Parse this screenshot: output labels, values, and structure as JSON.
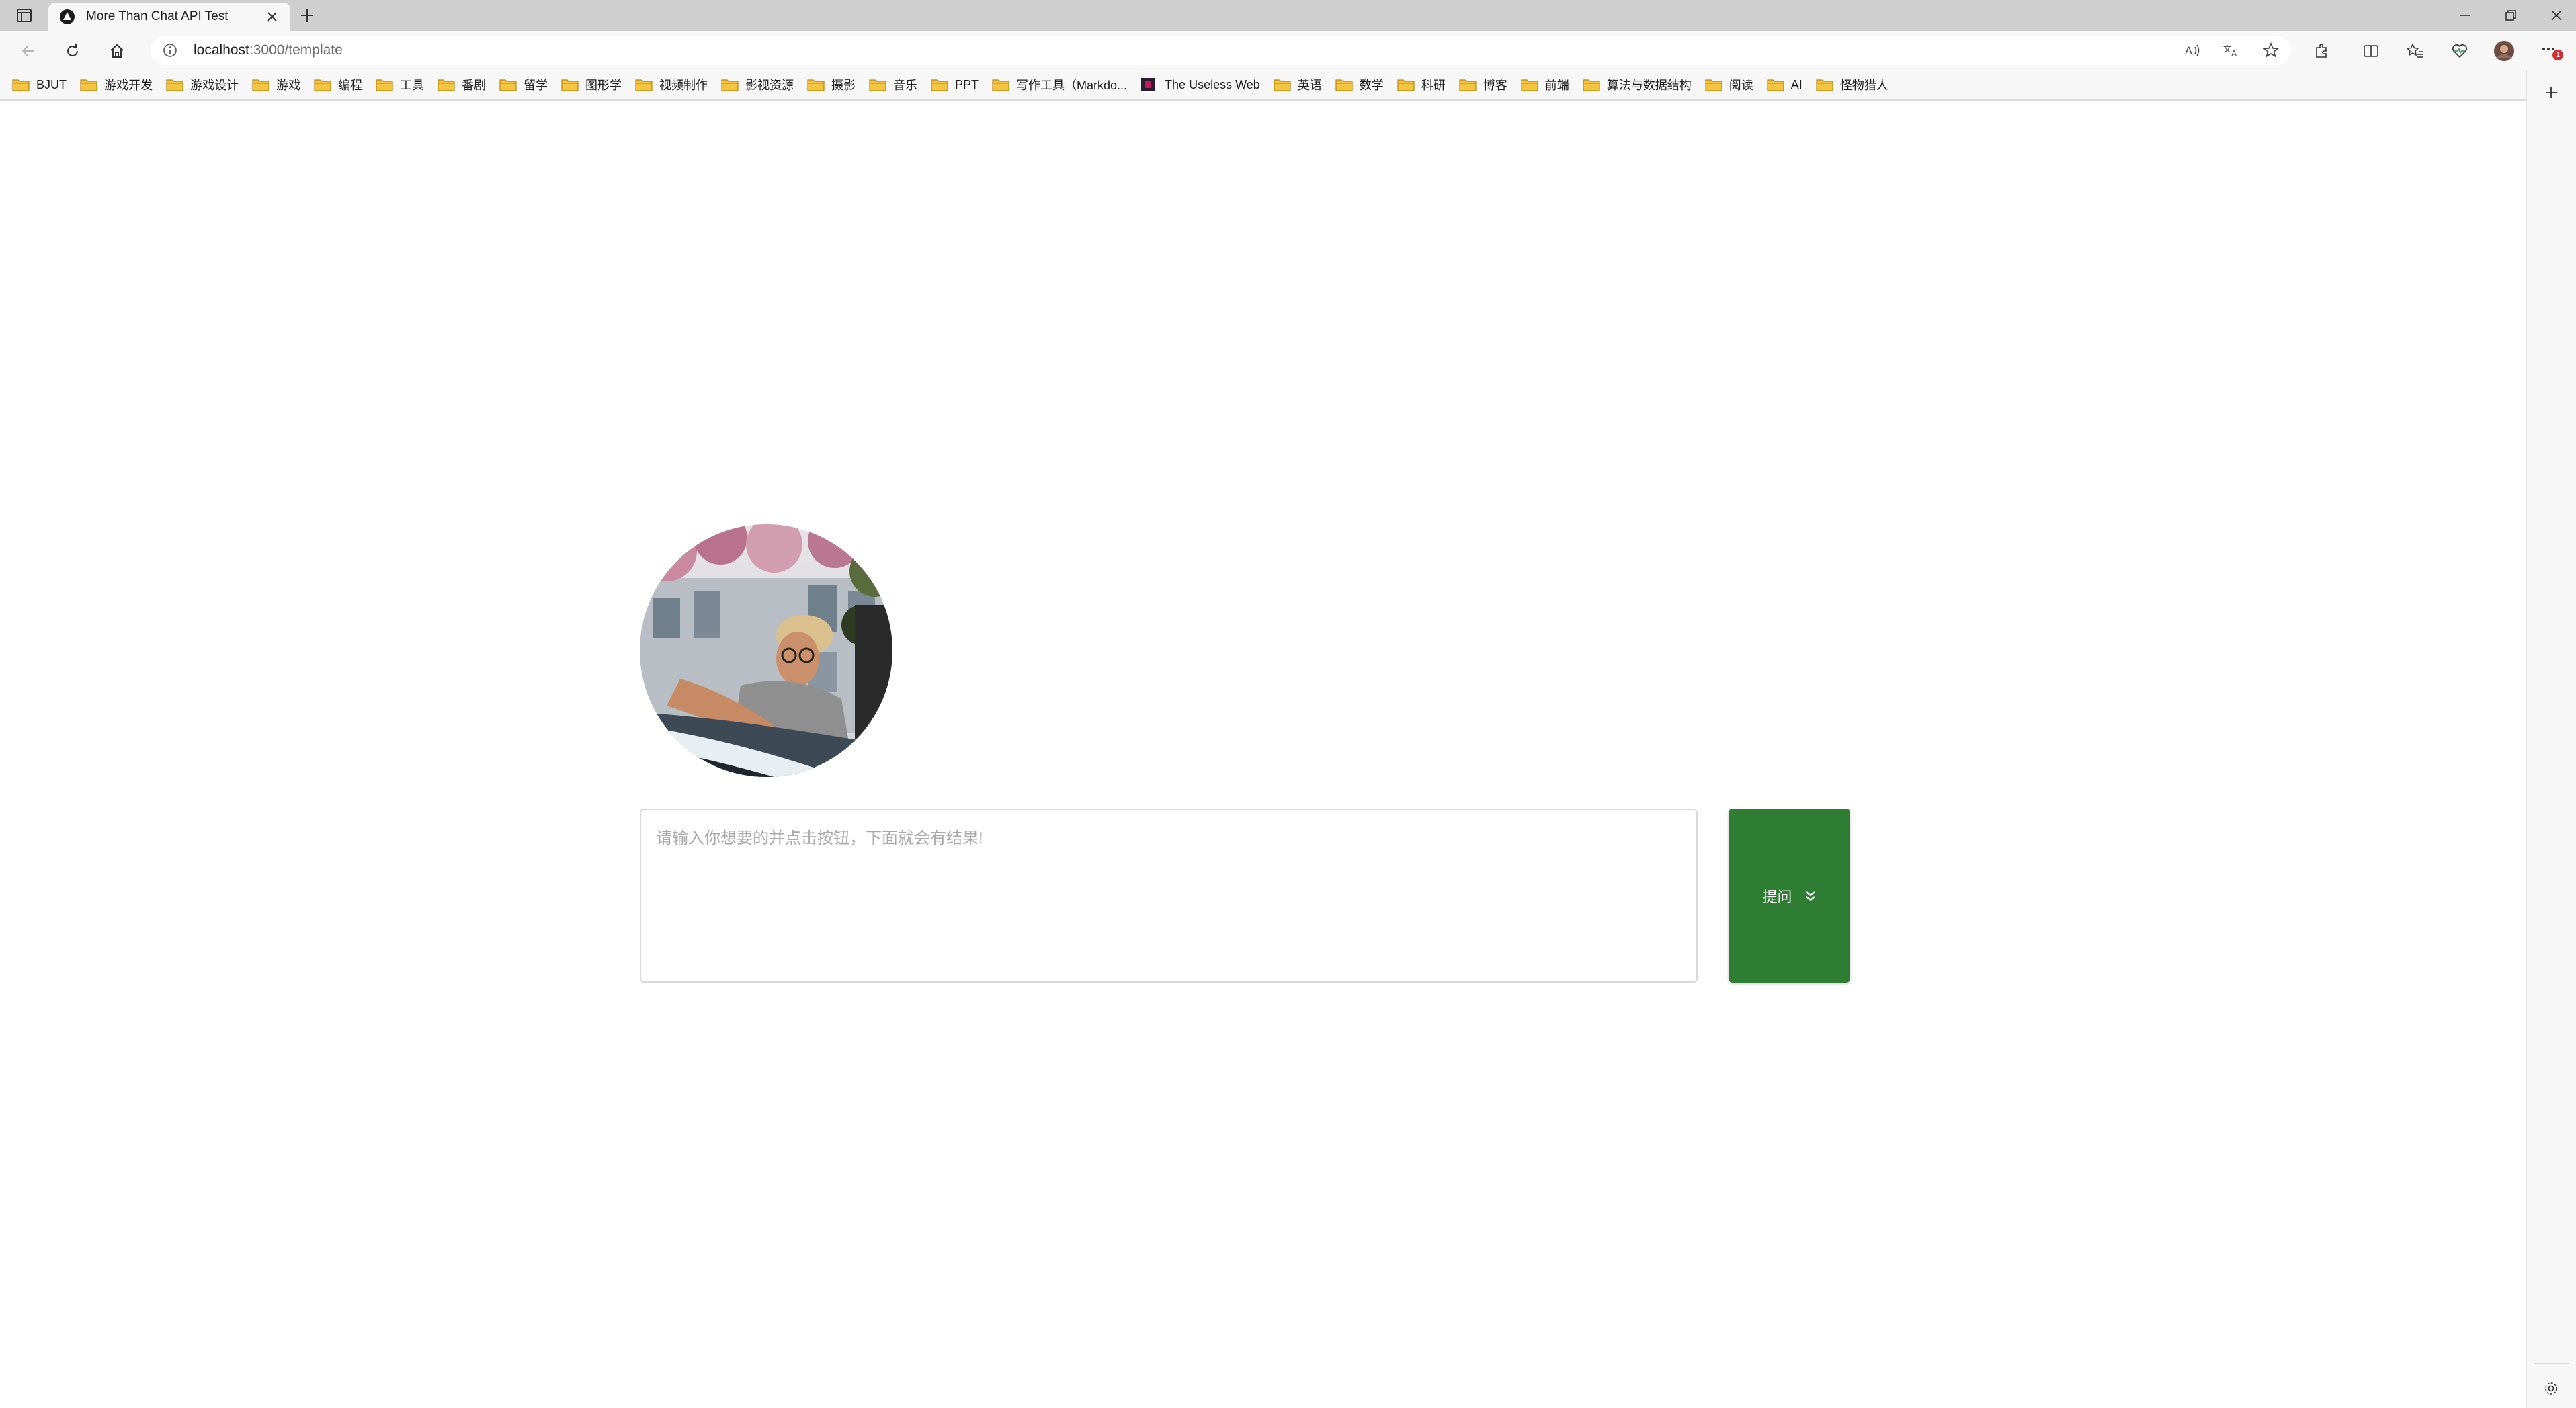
{
  "browser": {
    "tab": {
      "title": "More Than Chat API Test"
    },
    "address": {
      "host": "localhost",
      "path": ":3000/template"
    },
    "favorites": [
      {
        "label": "BJUT",
        "icon": "folder-icon"
      },
      {
        "label": "游戏开发",
        "icon": "folder-icon"
      },
      {
        "label": "游戏设计",
        "icon": "folder-icon"
      },
      {
        "label": "游戏",
        "icon": "folder-icon"
      },
      {
        "label": "编程",
        "icon": "folder-icon"
      },
      {
        "label": "工具",
        "icon": "folder-icon"
      },
      {
        "label": "番剧",
        "icon": "folder-icon"
      },
      {
        "label": "留学",
        "icon": "folder-icon"
      },
      {
        "label": "图形学",
        "icon": "folder-icon"
      },
      {
        "label": "视频制作",
        "icon": "folder-icon"
      },
      {
        "label": "影视资源",
        "icon": "folder-icon"
      },
      {
        "label": "摄影",
        "icon": "folder-icon"
      },
      {
        "label": "音乐",
        "icon": "folder-icon"
      },
      {
        "label": "PPT",
        "icon": "folder-icon"
      },
      {
        "label": "写作工具（Markdo...",
        "icon": "folder-icon"
      },
      {
        "label": "The Useless Web",
        "icon": "site-icon"
      },
      {
        "label": "英语",
        "icon": "folder-icon"
      },
      {
        "label": "数学",
        "icon": "folder-icon"
      },
      {
        "label": "科研",
        "icon": "folder-icon"
      },
      {
        "label": "博客",
        "icon": "folder-icon"
      },
      {
        "label": "前端",
        "icon": "folder-icon"
      },
      {
        "label": "算法与数据结构",
        "icon": "folder-icon"
      },
      {
        "label": "阅读",
        "icon": "folder-icon"
      },
      {
        "label": "AI",
        "icon": "folder-icon"
      },
      {
        "label": "怪物猎人",
        "icon": "folder-icon"
      }
    ],
    "notification_badge": "1"
  },
  "page": {
    "avatar": {
      "alt": "avatar",
      "icon": "avatar-photo"
    },
    "input": {
      "placeholder": "请输入你想要的并点击按钮，下面就会有结果!",
      "value": ""
    },
    "ask_button": {
      "label": "提问",
      "icon": "double-chevron-down-icon"
    }
  },
  "colors": {
    "accent": "#2e7d32",
    "tabstrip": "#cfcfcf",
    "toolbar": "#f7f7f7",
    "folder": "#f4c542"
  }
}
